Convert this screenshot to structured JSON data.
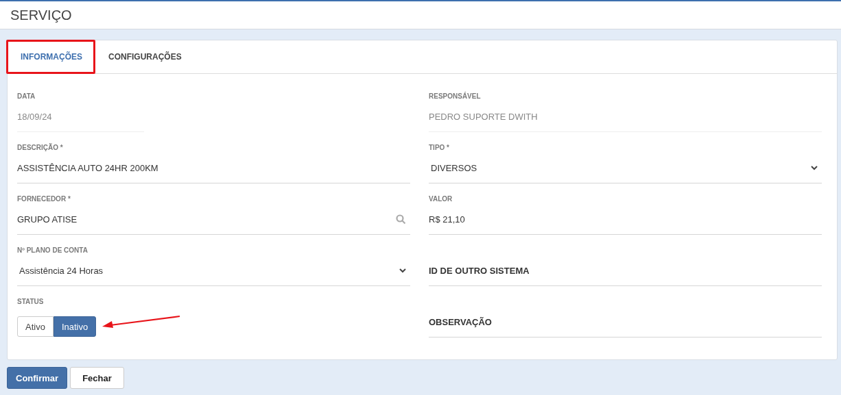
{
  "page": {
    "title": "SERVIÇO"
  },
  "tabs": [
    {
      "label": "INFORMAÇÕES",
      "selected": true,
      "highlighted": true
    },
    {
      "label": "CONFIGURAÇÕES",
      "selected": false,
      "highlighted": false
    }
  ],
  "left_column": [
    {
      "kind": "date",
      "label": "DATA",
      "value": "18/09/24"
    },
    {
      "kind": "text",
      "label": "DESCRIÇÃO *",
      "value": "ASSISTÊNCIA AUTO 24HR 200KM"
    },
    {
      "kind": "search",
      "label": "FORNECEDOR *",
      "value": "GRUPO ATISE"
    },
    {
      "kind": "select",
      "label": "Nº PLANO DE CONTA",
      "value": "Assistência 24 Horas"
    },
    {
      "kind": "toggle",
      "label": "STATUS",
      "options": [
        {
          "label": "Ativo",
          "selected": false
        },
        {
          "label": "Inativo",
          "selected": true
        }
      ],
      "arrow": true
    }
  ],
  "right_column": [
    {
      "kind": "readonly",
      "label": "RESPONSÁVEL",
      "value": "PEDRO SUPORTE DWITH"
    },
    {
      "kind": "select",
      "label": "TIPO *",
      "value": "DIVERSOS"
    },
    {
      "kind": "text",
      "label": "VALOR",
      "value": "R$ 21,10"
    },
    {
      "kind": "empty",
      "placeholder": "ID DE OUTRO SISTEMA"
    },
    {
      "kind": "empty",
      "placeholder": "OBSERVAÇÃO"
    }
  ],
  "buttons": [
    {
      "label": "Confirmar",
      "kind": "primary"
    },
    {
      "label": "Fechar",
      "kind": "secondary"
    }
  ]
}
